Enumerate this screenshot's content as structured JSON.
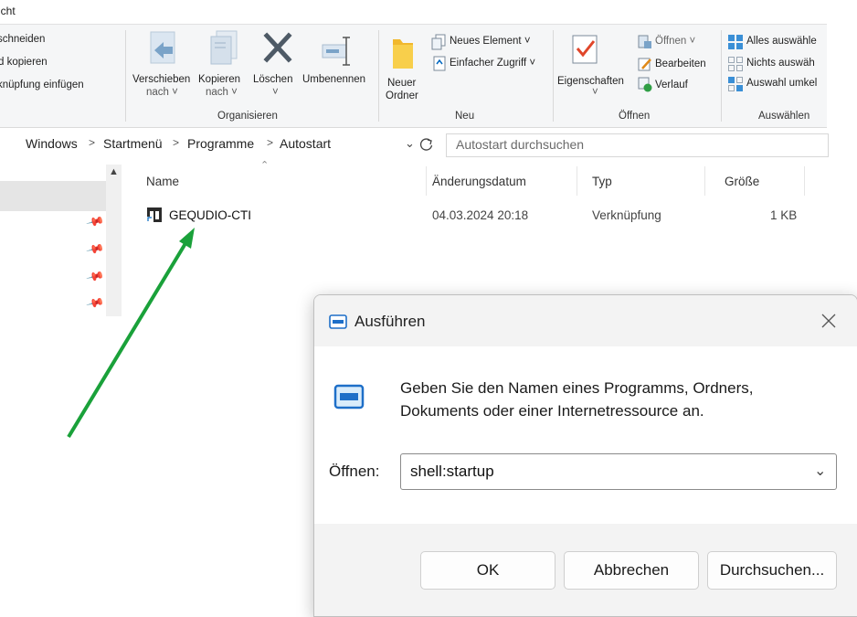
{
  "ribbon": {
    "tab_label": "icht",
    "clipboard": {
      "cut": "schneiden",
      "copy_path": "d kopieren",
      "paste_shortcut": "knüpfung einfügen"
    },
    "organize": {
      "move_to": "Verschieben",
      "move_to_sub": "nach ˅",
      "copy_to": "Kopieren",
      "copy_to_sub": "nach ˅",
      "delete": "Löschen",
      "delete_sub": "˅",
      "rename": "Umbenennen",
      "label": "Organisieren"
    },
    "new": {
      "new_folder": "Neuer",
      "new_folder_sub": "Ordner",
      "new_item": "Neues Element ˅",
      "easy_access": "Einfacher Zugriff ˅",
      "label": "Neu"
    },
    "open": {
      "properties": "Eigenschaften",
      "properties_sub": "˅",
      "open": "Öffnen ˅",
      "edit": "Bearbeiten",
      "history": "Verlauf",
      "label": "Öffnen"
    },
    "select": {
      "select_all": "Alles auswähle",
      "select_none": "Nichts auswäh",
      "invert": "Auswahl umkel",
      "label": "Auswählen"
    }
  },
  "address": {
    "crumbs": [
      "Windows",
      ">",
      "Startmenü",
      ">",
      "Programme",
      ">",
      "Autostart"
    ],
    "search_placeholder": "Autostart durchsuchen"
  },
  "filelist": {
    "columns": {
      "name": "Name",
      "date": "Änderungsdatum",
      "type": "Typ",
      "size": "Größe"
    },
    "rows": [
      {
        "name": "GEQUDIO-CTI",
        "date": "04.03.2024 20:18",
        "type": "Verknüpfung",
        "size": "1 KB"
      }
    ]
  },
  "run_dialog": {
    "title": "Ausführen",
    "message_line1": "Geben Sie den Namen eines Programms, Ordners,",
    "message_line2": "Dokuments oder einer Internetressource an.",
    "open_label": "Öffnen:",
    "command_value": "shell:startup",
    "ok_label": "OK",
    "cancel_label": "Abbrechen",
    "browse_label": "Durchsuchen..."
  },
  "colors": {
    "arrow": "#1aa13a",
    "accent": "#0067c0",
    "red_x": "#555555"
  }
}
